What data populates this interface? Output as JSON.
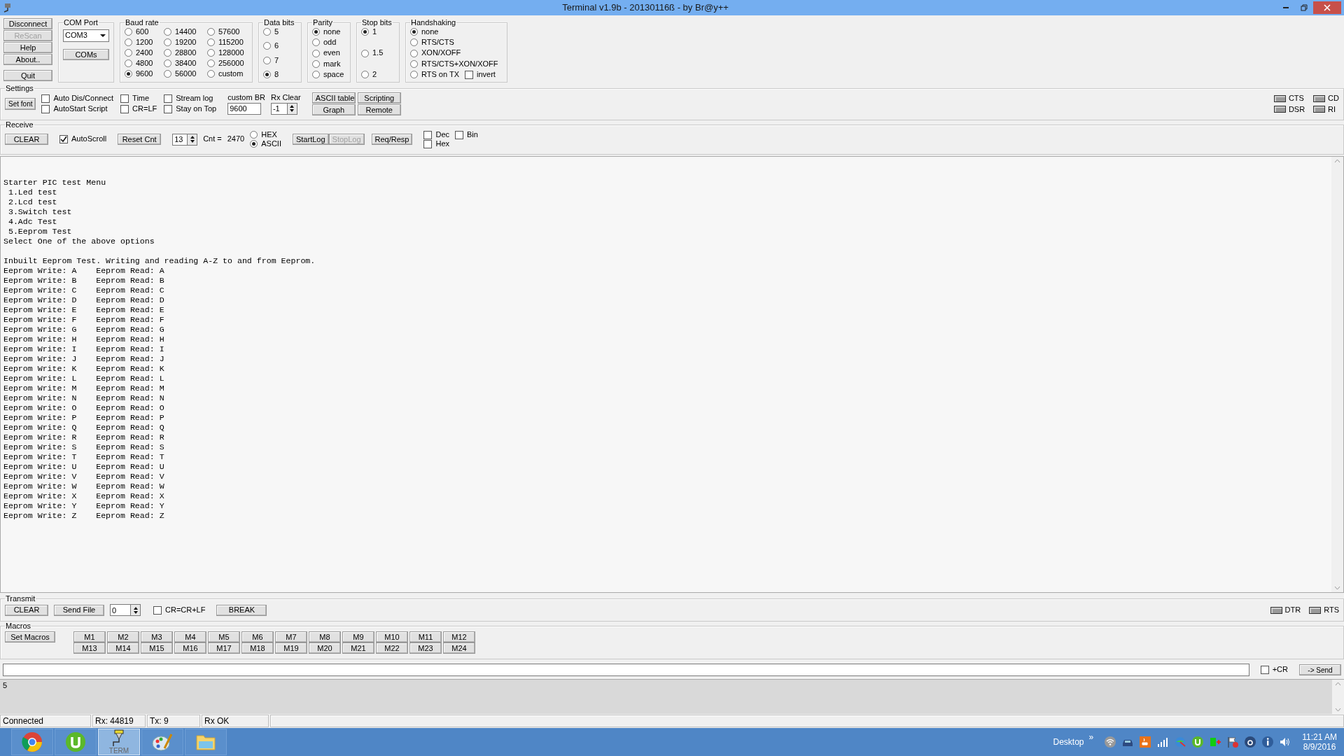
{
  "window": {
    "title": "Terminal v1.9b - 20130116ß - by Br@y++"
  },
  "side_buttons": [
    {
      "label": "Disconnect",
      "disabled": false
    },
    {
      "label": "ReScan",
      "disabled": true
    },
    {
      "label": "Help",
      "disabled": false
    },
    {
      "label": "About..",
      "disabled": false
    },
    {
      "label": "Quit",
      "disabled": false
    }
  ],
  "com_port": {
    "title": "COM Port",
    "value": "COM3",
    "button": "COMs"
  },
  "option_groups": [
    {
      "title": "Baud rate",
      "options": [
        {
          "label": "600",
          "selected": false
        },
        {
          "label": "1200",
          "selected": false
        },
        {
          "label": "2400",
          "selected": false
        },
        {
          "label": "4800",
          "selected": false
        },
        {
          "label": "9600",
          "selected": true
        },
        {
          "label": "14400",
          "selected": false
        },
        {
          "label": "19200",
          "selected": false
        },
        {
          "label": "28800",
          "selected": false
        },
        {
          "label": "38400",
          "selected": false
        },
        {
          "label": "56000",
          "selected": false
        },
        {
          "label": "57600",
          "selected": false
        },
        {
          "label": "115200",
          "selected": false
        },
        {
          "label": "128000",
          "selected": false
        },
        {
          "label": "256000",
          "selected": false
        },
        {
          "label": "custom",
          "selected": false
        }
      ]
    },
    {
      "title": "Data bits",
      "options": [
        {
          "label": "5",
          "selected": false
        },
        {
          "label": "6",
          "selected": false
        },
        {
          "label": "7",
          "selected": false
        },
        {
          "label": "8",
          "selected": true
        }
      ]
    },
    {
      "title": "Parity",
      "options": [
        {
          "label": "none",
          "selected": true
        },
        {
          "label": "odd",
          "selected": false
        },
        {
          "label": "even",
          "selected": false
        },
        {
          "label": "mark",
          "selected": false
        },
        {
          "label": "space",
          "selected": false
        }
      ]
    },
    {
      "title": "Stop bits",
      "options": [
        {
          "label": "1",
          "selected": true
        },
        {
          "label": "1.5",
          "selected": false
        },
        {
          "label": "2",
          "selected": false
        }
      ]
    },
    {
      "title": "Handshaking",
      "options": [
        {
          "label": "none",
          "selected": true
        },
        {
          "label": "RTS/CTS",
          "selected": false
        },
        {
          "label": "XON/XOFF",
          "selected": false
        },
        {
          "label": "RTS/CTS+XON/XOFF",
          "selected": false
        },
        {
          "label": "RTS on TX",
          "selected": false
        }
      ],
      "invert": {
        "label": "invert",
        "checked": false
      }
    }
  ],
  "settings": {
    "title": "Settings",
    "set_font": "Set font",
    "checkboxes": [
      {
        "label": "Auto Dis/Connect",
        "checked": false
      },
      {
        "label": "AutoStart Script",
        "checked": false
      },
      {
        "label": "Time",
        "checked": false
      },
      {
        "label": "CR=LF",
        "checked": false
      },
      {
        "label": "Stream log",
        "checked": false
      },
      {
        "label": "Stay on Top",
        "checked": false
      }
    ],
    "custom_br": {
      "label": "custom BR",
      "value": "9600"
    },
    "rx_clear": {
      "label": "Rx Clear",
      "value": "-1"
    },
    "buttons": [
      "ASCII table",
      "Scripting",
      "Graph",
      "Remote"
    ],
    "indicators": [
      {
        "label": "CTS",
        "on": false
      },
      {
        "label": "CD",
        "on": false
      },
      {
        "label": "DSR",
        "on": false
      },
      {
        "label": "RI",
        "on": false
      }
    ]
  },
  "receive": {
    "title": "Receive",
    "clear": "CLEAR",
    "autoscroll": {
      "label": "AutoScroll",
      "checked": true
    },
    "reset_cnt": "Reset Cnt",
    "spin": "13",
    "cnt_label": "Cnt =",
    "cnt_value": "2470",
    "modes": [
      {
        "label": "HEX",
        "selected": false
      },
      {
        "label": "ASCII",
        "selected": true
      }
    ],
    "buttons": [
      {
        "label": "StartLog",
        "disabled": false
      },
      {
        "label": "StopLog",
        "disabled": true
      },
      {
        "label": "Req/Resp",
        "disabled": false
      }
    ],
    "formats": [
      {
        "label": "Dec",
        "checked": false
      },
      {
        "label": "Hex",
        "checked": false
      },
      {
        "label": "Bin",
        "checked": false
      }
    ]
  },
  "output": "Starter PIC test Menu\n 1.Led test\n 2.Lcd test\n 3.Switch test\n 4.Adc Test\n 5.Eeprom Test\nSelect One of the above options\n\nInbuilt Eeprom Test. Writing and reading A-Z to and from Eeprom.\nEeprom Write: A    Eeprom Read: A\nEeprom Write: B    Eeprom Read: B\nEeprom Write: C    Eeprom Read: C\nEeprom Write: D    Eeprom Read: D\nEeprom Write: E    Eeprom Read: E\nEeprom Write: F    Eeprom Read: F\nEeprom Write: G    Eeprom Read: G\nEeprom Write: H    Eeprom Read: H\nEeprom Write: I    Eeprom Read: I\nEeprom Write: J    Eeprom Read: J\nEeprom Write: K    Eeprom Read: K\nEeprom Write: L    Eeprom Read: L\nEeprom Write: M    Eeprom Read: M\nEeprom Write: N    Eeprom Read: N\nEeprom Write: O    Eeprom Read: O\nEeprom Write: P    Eeprom Read: P\nEeprom Write: Q    Eeprom Read: Q\nEeprom Write: R    Eeprom Read: R\nEeprom Write: S    Eeprom Read: S\nEeprom Write: T    Eeprom Read: T\nEeprom Write: U    Eeprom Read: U\nEeprom Write: V    Eeprom Read: V\nEeprom Write: W    Eeprom Read: W\nEeprom Write: X    Eeprom Read: X\nEeprom Write: Y    Eeprom Read: Y\nEeprom Write: Z    Eeprom Read: Z",
  "transmit": {
    "title": "Transmit",
    "clear": "CLEAR",
    "send_file": "Send File",
    "spin": "0",
    "cr_lf": {
      "label": "CR=CR+LF",
      "checked": false
    },
    "break": "BREAK",
    "indicators": [
      {
        "label": "DTR",
        "on": false
      },
      {
        "label": "RTS",
        "on": false
      }
    ]
  },
  "macros": {
    "title": "Macros",
    "set_macros": "Set Macros",
    "buttons": [
      "M1",
      "M2",
      "M3",
      "M4",
      "M5",
      "M6",
      "M7",
      "M8",
      "M9",
      "M10",
      "M11",
      "M12",
      "M13",
      "M14",
      "M15",
      "M16",
      "M17",
      "M18",
      "M19",
      "M20",
      "M21",
      "M22",
      "M23",
      "M24"
    ]
  },
  "send_row": {
    "plus_cr": {
      "label": "+CR",
      "checked": false
    },
    "send": "-> Send"
  },
  "history": "5",
  "status_bar": [
    "Connected",
    "Rx: 44819",
    "Tx: 9",
    "Rx OK"
  ],
  "taskbar": {
    "apps": [
      {
        "kind": "chrome",
        "selected": false
      },
      {
        "kind": "torrent",
        "selected": false
      },
      {
        "kind": "terminal",
        "label": "TERM",
        "selected": true
      },
      {
        "kind": "paint",
        "selected": false
      },
      {
        "kind": "folder",
        "selected": false
      }
    ],
    "desktop": "Desktop",
    "chevron": "»",
    "time": "11:21 AM",
    "date": "8/9/2016"
  }
}
